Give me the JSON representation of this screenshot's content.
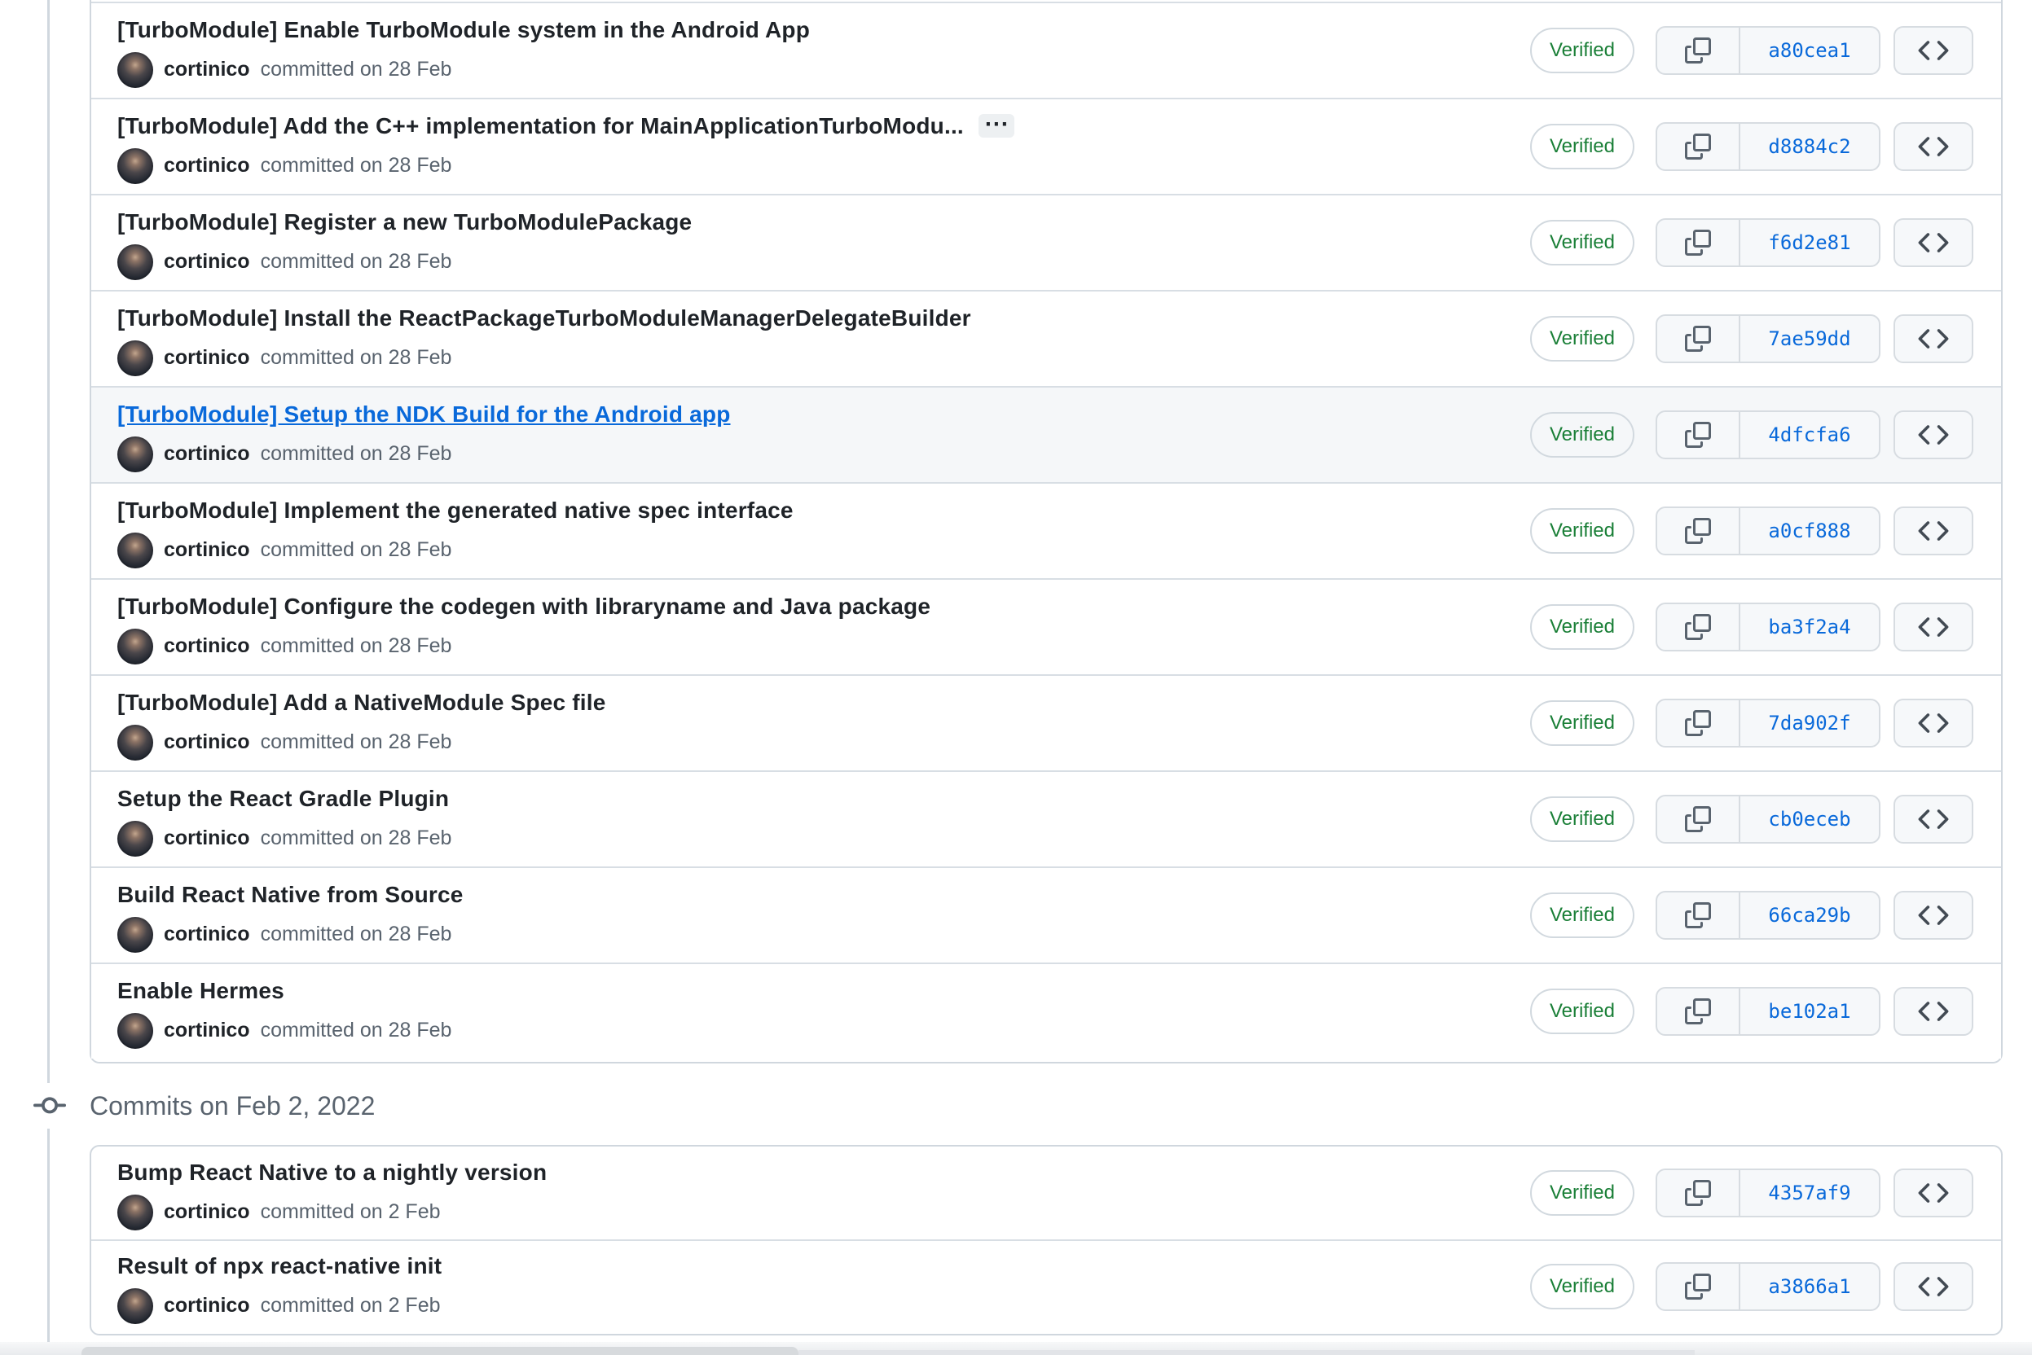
{
  "labels": {
    "verified": "Verified",
    "ellipsis": "⋯"
  },
  "colors": {
    "link_blue": "#0969da",
    "verified_green": "#1a7f37",
    "title_text": "#1f2328",
    "muted_text": "#59636e",
    "border": "#d0d7de",
    "button_bg": "#f6f8fa",
    "highlight_row_bg": "#f5f7f9"
  },
  "icons": {
    "copy": "copy-icon",
    "code": "code-icon",
    "commit": "git-commit-icon",
    "ellipsis": "ellipsis-icon"
  },
  "groups": [
    {
      "commits": [
        {
          "title": "[TurboModule] Enable TurboModule system in the Android App",
          "author": "cortinico",
          "date_text": "committed on 28 Feb",
          "sha": "a80cea1"
        },
        {
          "title": "[TurboModule] Add the C++ implementation for MainApplicationTurboModu...",
          "author": "cortinico",
          "date_text": "committed on 28 Feb",
          "sha": "d8884c2",
          "expander": true
        },
        {
          "title": "[TurboModule] Register a new TurboModulePackage",
          "author": "cortinico",
          "date_text": "committed on 28 Feb",
          "sha": "f6d2e81"
        },
        {
          "title": "[TurboModule] Install the ReactPackageTurboModuleManagerDelegateBuilder",
          "author": "cortinico",
          "date_text": "committed on 28 Feb",
          "sha": "7ae59dd"
        },
        {
          "title": "[TurboModule] Setup the NDK Build for the Android app",
          "author": "cortinico",
          "date_text": "committed on 28 Feb",
          "sha": "4dfcfa6",
          "link_style": true,
          "row_highlight": true
        },
        {
          "title": "[TurboModule] Implement the generated native spec interface",
          "author": "cortinico",
          "date_text": "committed on 28 Feb",
          "sha": "a0cf888"
        },
        {
          "title": "[TurboModule] Configure the codegen with libraryname and Java package",
          "author": "cortinico",
          "date_text": "committed on 28 Feb",
          "sha": "ba3f2a4"
        },
        {
          "title": "[TurboModule] Add a NativeModule Spec file",
          "author": "cortinico",
          "date_text": "committed on 28 Feb",
          "sha": "7da902f"
        },
        {
          "title": "Setup the React Gradle Plugin",
          "author": "cortinico",
          "date_text": "committed on 28 Feb",
          "sha": "cb0eceb"
        },
        {
          "title": "Build React Native from Source",
          "author": "cortinico",
          "date_text": "committed on 28 Feb",
          "sha": "66ca29b"
        },
        {
          "title": "Enable Hermes",
          "author": "cortinico",
          "date_text": "committed on 28 Feb",
          "sha": "be102a1"
        }
      ]
    },
    {
      "header": "Commits on Feb 2, 2022",
      "commits": [
        {
          "title": "Bump React Native to a nightly version",
          "author": "cortinico",
          "date_text": "committed on 2 Feb",
          "sha": "4357af9"
        },
        {
          "title": "Result of npx react-native init",
          "author": "cortinico",
          "date_text": "committed on 2 Feb",
          "sha": "a3866a1"
        }
      ]
    }
  ]
}
